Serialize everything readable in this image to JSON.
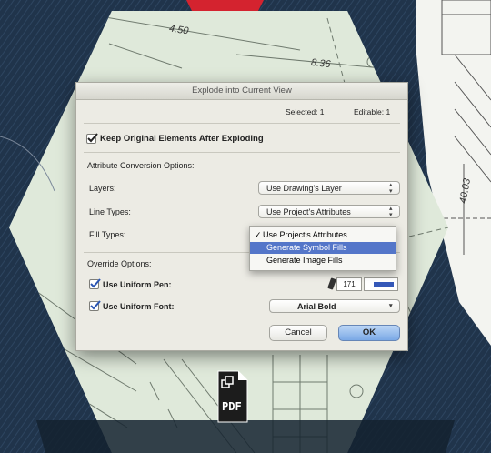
{
  "drawing": {
    "dimensions": [
      "4.50",
      "8.36",
      "40.03"
    ]
  },
  "dialog": {
    "title": "Explode into Current View",
    "selected": "Selected: 1",
    "editable": "Editable: 1",
    "keep_original": {
      "label": "Keep Original Elements After Exploding",
      "checked": true
    },
    "attr_section": "Attribute Conversion Options:",
    "layers": {
      "label": "Layers:",
      "value": "Use Drawing's Layer"
    },
    "line_types": {
      "label": "Line Types:",
      "value": "Use Project's Attributes"
    },
    "fill_types": {
      "label": "Fill Types:",
      "options": [
        "Use Project's Attributes",
        "Generate Symbol Fills",
        "Generate Image Fills"
      ],
      "checked_index": 0,
      "highlighted_index": 1
    },
    "override_section": "Override Options:",
    "uniform_pen": {
      "label": "Use Uniform Pen:",
      "checked": true,
      "pen_number": "171"
    },
    "uniform_font": {
      "label": "Use Uniform Font:",
      "checked": true,
      "value": "Arial Bold"
    },
    "cancel_label": "Cancel",
    "ok_label": "OK"
  },
  "pdf_badge": "PDF",
  "colors": {
    "accent_red": "#d4232f",
    "selection_blue": "#5476c9",
    "pen_color": "#3558b8"
  }
}
